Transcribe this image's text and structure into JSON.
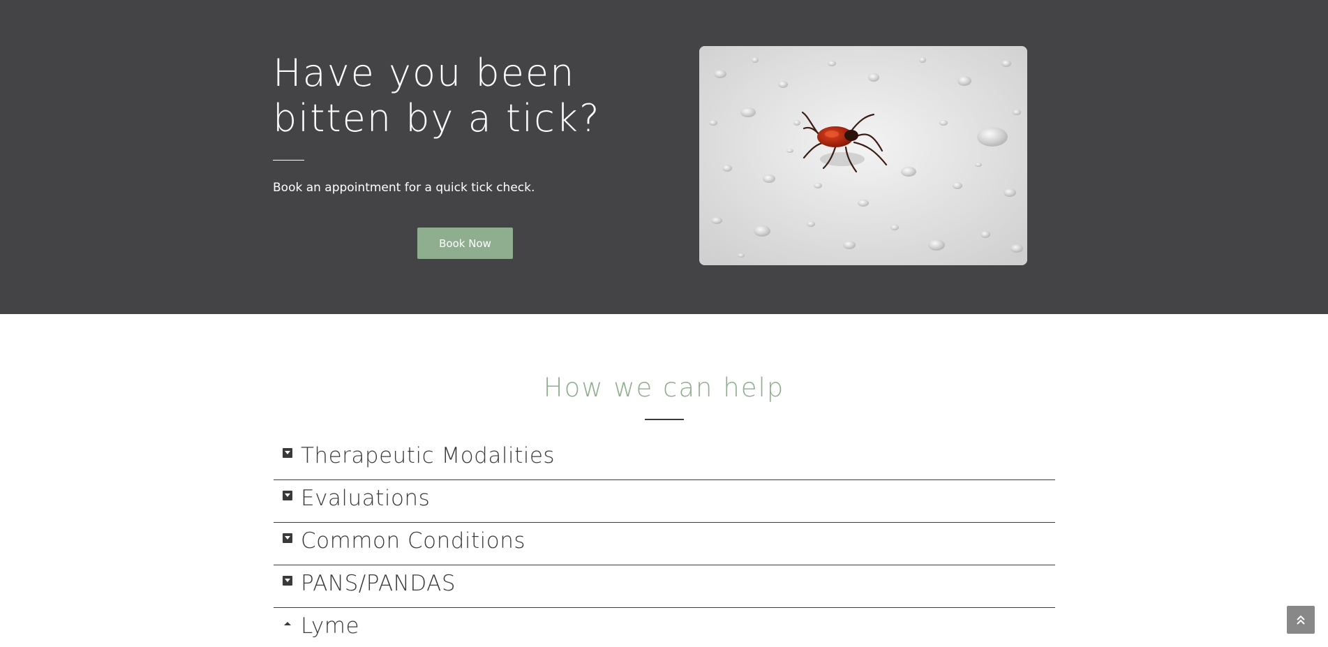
{
  "hero": {
    "title": "Have you been bitten by a tick?",
    "subtitle": "Book an appointment for a quick tick check.",
    "button_label": "Book Now",
    "background_color": "#444446",
    "button_color": "#8fad8f",
    "image_icon": "tick-on-water-drops-photo"
  },
  "help": {
    "title": "How we can help",
    "title_color": "#8fad8f",
    "accordion": [
      {
        "label": "Therapeutic Modalities",
        "icon": "caret-down-square-icon",
        "expanded": false
      },
      {
        "label": "Evaluations",
        "icon": "caret-down-square-icon",
        "expanded": false
      },
      {
        "label": "Common Conditions",
        "icon": "caret-down-square-icon",
        "expanded": false
      },
      {
        "label": "PANS/PANDAS",
        "icon": "caret-down-square-icon",
        "expanded": false
      },
      {
        "label": "Lyme",
        "icon": "caret-up-icon",
        "expanded": true
      }
    ]
  },
  "scroll_top": {
    "icon": "double-chevron-up-icon"
  }
}
